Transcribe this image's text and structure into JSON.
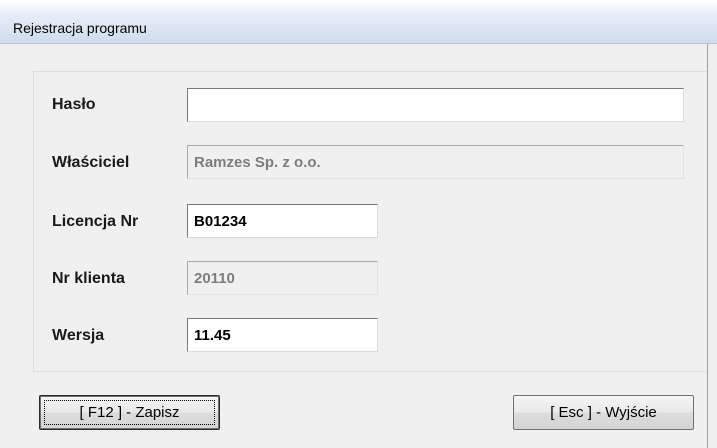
{
  "window": {
    "title": "Rejestracja programu"
  },
  "form": {
    "haslo": {
      "label": "Hasło",
      "value": ""
    },
    "wlasciciel": {
      "label": "Właściciel",
      "value": "Ramzes Sp. z o.o."
    },
    "licencja": {
      "label": "Licencja Nr",
      "value": "B01234"
    },
    "nr_klienta": {
      "label": "Nr klienta",
      "value": "20110"
    },
    "wersja": {
      "label": "Wersja",
      "value": "11.45"
    }
  },
  "buttons": {
    "save_label": "[ F12 ] - Zapisz",
    "exit_label": "[ Esc ] - Wyjście"
  }
}
